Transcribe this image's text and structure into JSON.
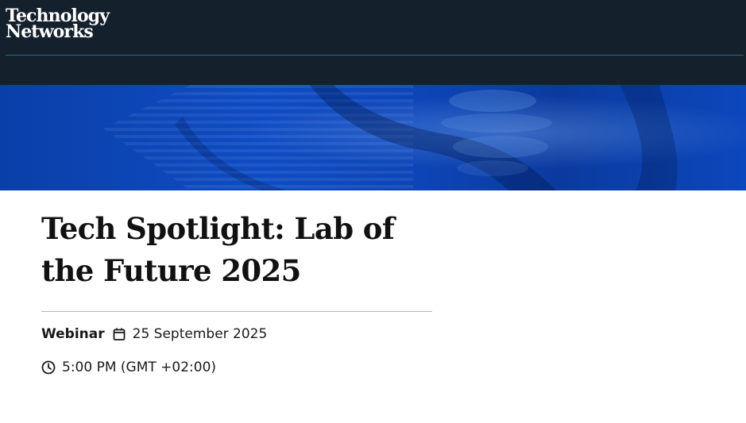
{
  "header": {
    "logo_line1": "Technology",
    "logo_line2": "Networks",
    "background_color": "#14202c",
    "rule_color": "#1f6d95"
  },
  "banner": {
    "primary_color": "#0f4cc4"
  },
  "event": {
    "title": "Tech Spotlight: Lab of the Future 2025",
    "type": "Webinar",
    "date": "25 September 2025",
    "time": "5:00 PM (GMT +02:00)",
    "date_icon": "calendar-icon",
    "time_icon": "clock-icon"
  }
}
